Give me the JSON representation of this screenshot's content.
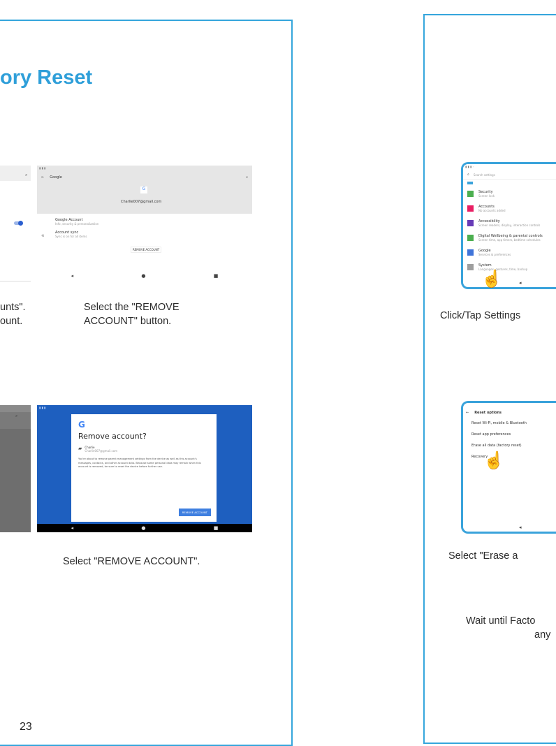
{
  "title": "ory Reset",
  "page_number": "23",
  "left": {
    "shot_top_right": {
      "header": "Google",
      "email": "Charlie007@gmail.com",
      "row1_title": "Google Account",
      "row1_sub": "Info, security & personalization",
      "row2_title": "Account sync",
      "row2_sub": "Sync is on for all items",
      "button": "REMOVE ACCOUNT"
    },
    "caption_top_left": "unts\".\nount.",
    "caption_top_right": "Select the \"REMOVE\nACCOUNT\" button.",
    "shot_bottom_right": {
      "heading": "Remove account?",
      "account_name": "Charlie",
      "account_sub": "Charlie007@gmail.com",
      "body": "You're about to remove parent management settings from the device as well as this account's messages, contacts, and other account data. Because some personal data may remain when this account is removed, be sure to reset the device before further use.",
      "button": "REMOVE ACCOUNT"
    },
    "caption_bottom_right": "Select \"REMOVE ACCOUNT\"."
  },
  "right": {
    "shot_settings": {
      "search": "Search settings",
      "items": [
        {
          "title": "Security",
          "sub": "Screen lock",
          "color": "#4caf50"
        },
        {
          "title": "Accounts",
          "sub": "No accounts added",
          "color": "#e91e63"
        },
        {
          "title": "Accessibility",
          "sub": "Screen readers, display, interaction controls",
          "color": "#673ab7"
        },
        {
          "title": "Digital Wellbeing & parental controls",
          "sub": "Screen time, app timers, bedtime schedules",
          "color": "#4caf50"
        },
        {
          "title": "Google",
          "sub": "Services & preferences",
          "color": "#3f74d9"
        },
        {
          "title": "System",
          "sub": "Languages, gestures, time, backup",
          "color": "#9e9e9e"
        }
      ]
    },
    "caption_settings": "Click/Tap Settings",
    "shot_reset": {
      "header": "Reset options",
      "items": [
        "Reset Wi-Fi, mobile & Bluetooth",
        "Reset app preferences",
        "Erase all data (factory reset)",
        "Recovery"
      ]
    },
    "caption_reset": "Select \"Erase a",
    "caption_wait_1": "Wait until Facto",
    "caption_wait_2": "any"
  },
  "colors": {
    "accent": "#2f9fd9",
    "frame": "#35a6dc",
    "android_blue": "#1e5fbf"
  }
}
